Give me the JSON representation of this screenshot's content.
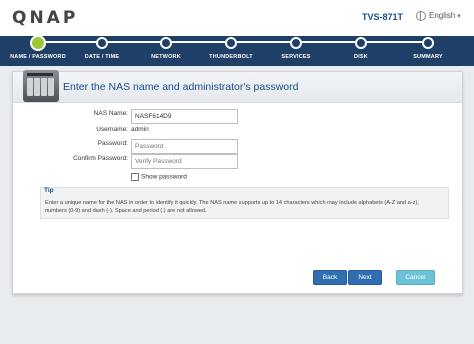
{
  "brand": {
    "logo": "QNAP",
    "model": "TVS-871T",
    "language": "English"
  },
  "steps": [
    {
      "label": "NAME / PASSWORD",
      "active": true
    },
    {
      "label": "DATE / TIME",
      "active": false
    },
    {
      "label": "NETWORK",
      "active": false
    },
    {
      "label": "THUNDERBOLT",
      "active": false
    },
    {
      "label": "SERVICES",
      "active": false
    },
    {
      "label": "DISK",
      "active": false
    },
    {
      "label": "SUMMARY",
      "active": false
    }
  ],
  "panel": {
    "title": "Enter the NAS name and administrator's password",
    "fields": {
      "nas_name": {
        "label": "NAS Name:",
        "value": "NASF614D9"
      },
      "username": {
        "label": "Username:",
        "value": "admin"
      },
      "password": {
        "label": "Password:",
        "placeholder": "Password"
      },
      "confirm_password": {
        "label": "Confirm Password:",
        "placeholder": "Verify Password"
      }
    },
    "show_password": "Show password",
    "tip": {
      "title": "Tip",
      "text": "Enter a unique name for the NAS in order to identify it quickly. The NAS name supports up to 14 characters which may include alphabets (A-Z and a-z), numbers (0-9) and dash (-). Space and period (.) are not allowed."
    },
    "buttons": {
      "back": "Back",
      "next": "Next",
      "cancel": "Cancel"
    }
  },
  "colors": {
    "step_bar": "#1f3f66",
    "active_step": "#9cc933",
    "title": "#1a4f8b",
    "primary_button": "#2f6fb1",
    "cancel_button": "#6cc2d6"
  }
}
